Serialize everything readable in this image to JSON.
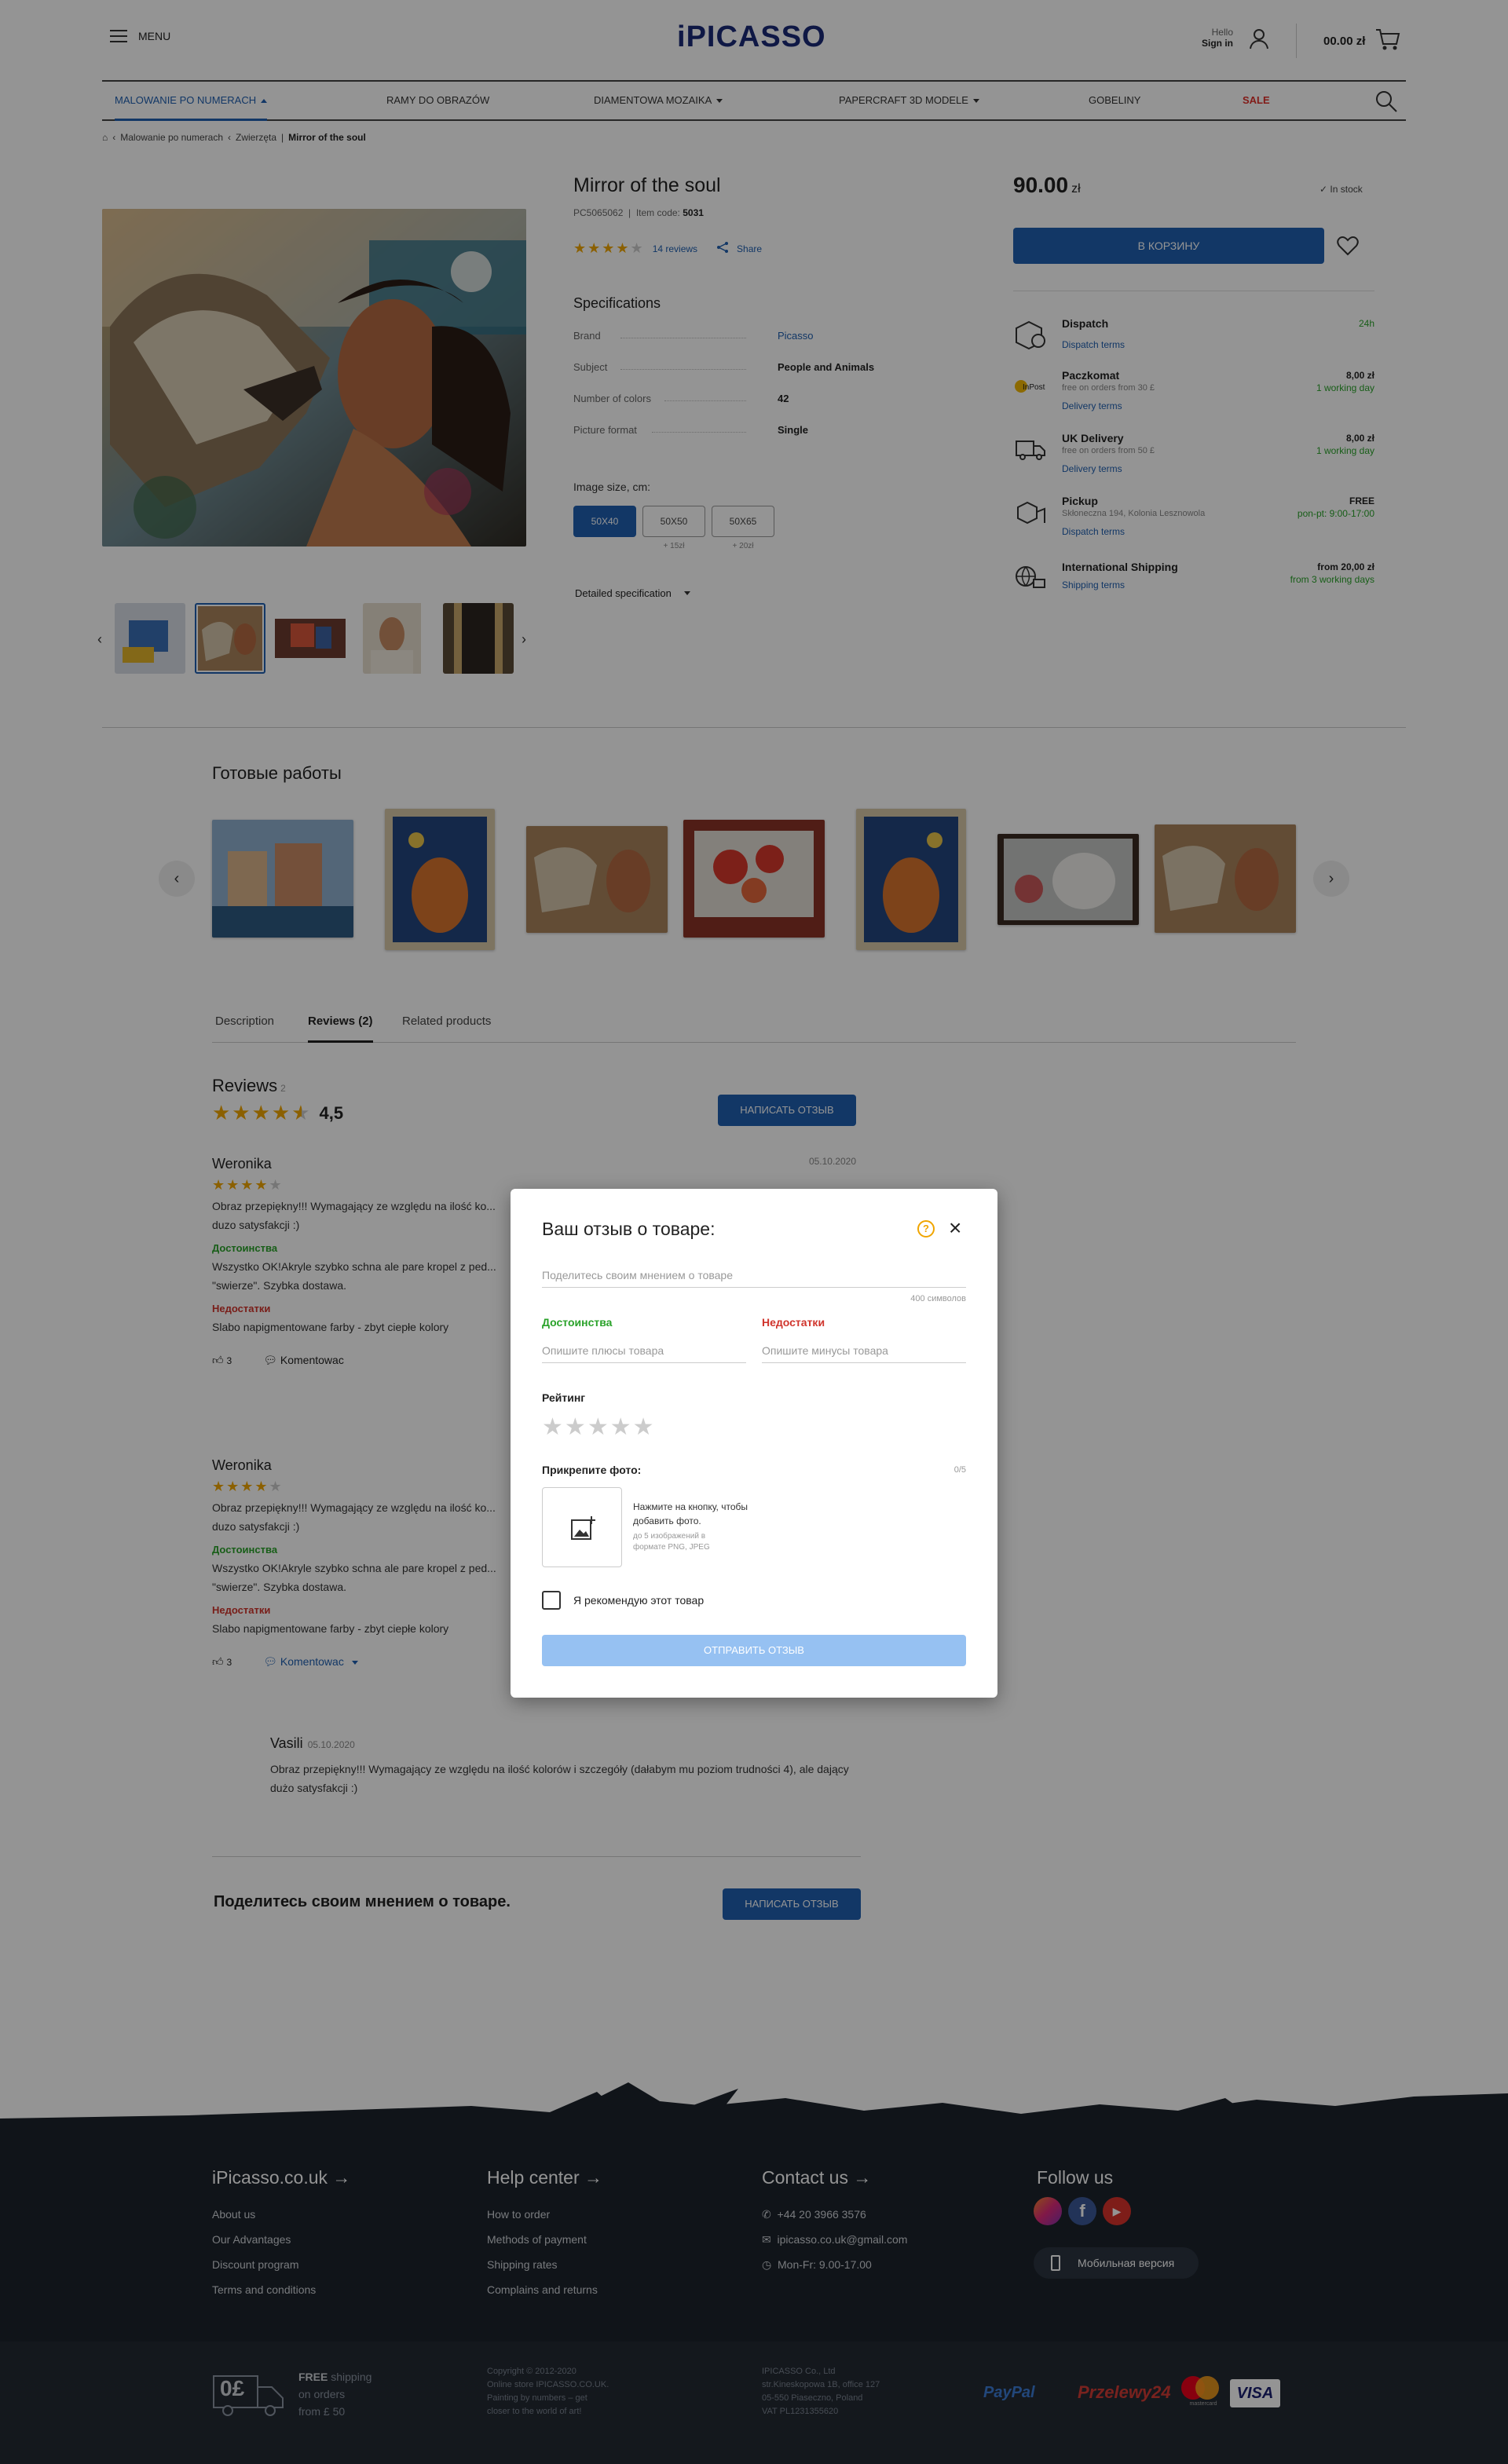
{
  "header": {
    "menu_label": "MENU",
    "logo_prefix": "i",
    "logo_main": "PICASSO",
    "hello": "Hello",
    "sign_in": "Sign in",
    "cart_total": "00.00 zł"
  },
  "nav": {
    "items": [
      "MALOWANIE PO NUMERACH",
      "RAMY DO OBRAZÓW",
      "DIAMENTOWA MOZAIKA",
      "PAPERCRAFT 3D MODELE",
      "GOBELINY",
      "SALE"
    ]
  },
  "breadcrumb": {
    "items": [
      "Malowanie po numerach",
      "Zwierzęta"
    ],
    "current": "Mirror of the soul"
  },
  "product": {
    "title": "Mirror of the soul",
    "code_label": "PC5065062",
    "item_code_label": "Item code:",
    "item_code": "5031",
    "reviews_link": "14 reviews",
    "share": "Share",
    "specs_title": "Specifications",
    "specs": [
      {
        "k": "Brand",
        "v": "Picasso"
      },
      {
        "k": "Subject",
        "v": "People and Animals"
      },
      {
        "k": "Number of colors",
        "v": "42"
      },
      {
        "k": "Picture format",
        "v": "Single"
      }
    ],
    "image_size_label": "Image size, cm:",
    "sizes": [
      {
        "label": "50X40",
        "extra": ""
      },
      {
        "label": "50X50",
        "extra": "+ 15zł"
      },
      {
        "label": "50X65",
        "extra": "+ 20zł"
      }
    ],
    "detailed": "Detailed specification",
    "price": "90.00",
    "currency": "zł",
    "stock": "In stock",
    "buy": "В КОРЗИНУ"
  },
  "shipping": [
    {
      "title": "Dispatch",
      "sub": "",
      "link": "Dispatch terms",
      "r1": "",
      "r2": "24h"
    },
    {
      "title": "Paczkomat",
      "sub": "free on orders from 30 £",
      "link": "Delivery terms",
      "r1": "8,00 zł",
      "r2": "1 working day"
    },
    {
      "title": "UK Delivery",
      "sub": "free on orders from 50 £",
      "link": "Delivery terms",
      "r1": "8,00 zł",
      "r2": "1 working day"
    },
    {
      "title": "Pickup",
      "sub": "Skłoneczna 194, Kolonia Lesznowola",
      "link": "Dispatch terms",
      "r1": "FREE",
      "r2": "pon-pt: 9:00-17:00"
    },
    {
      "title": "International Shipping",
      "sub": "",
      "link": "Shipping terms",
      "r1": "from 20,00 zł",
      "r2": "from 3 working days"
    }
  ],
  "works": {
    "title": "Готовые работы"
  },
  "tabs": [
    "Description",
    "Reviews (2)",
    "Related products"
  ],
  "reviews": {
    "title": "Reviews",
    "count": "2",
    "average": "4,5",
    "average_value": 4.5,
    "write_btn": "НАПИСАТЬ ОТЗЫВ",
    "items": [
      {
        "name": "Weronika",
        "rating": 4,
        "date": "05.10.2020",
        "text": "Obraz przepiękny!!! Wymagający ze względu na ilość ko...\nduzo satysfakcji :)",
        "pros_label": "Достоинства",
        "pros": "Wszystko OK!Akryle szybko schna ale pare kropel z ped...\n\"swierze\". Szybka dostawa.",
        "cons_label": "Недостатки",
        "cons": "Slabo napigmentowane farby - zbyt ciepłe kolory",
        "likes": "3",
        "comment": "Komentowac"
      },
      {
        "name": "Weronika",
        "rating": 4,
        "date": "",
        "text": "Obraz przepiękny!!! Wymagający ze względu na ilość ko...\nduzo satysfakcji :)",
        "pros_label": "Достоинства",
        "pros": "Wszystko OK!Akryle szybko schna ale pare kropel z ped...\n\"swierze\". Szybka dostawa.",
        "cons_label": "Недостатки",
        "cons": "Slabo napigmentowane farby - zbyt ciepłe kolory",
        "likes": "3",
        "comment": "Komentowac"
      }
    ],
    "reply": {
      "name": "Vasili",
      "date": "05.10.2020",
      "text": "Obraz przepiękny!!! Wymagający ze względu na ilość kolorów i szczegóły (dałabym mu poziom trudności 4), ale dający dużo satysfakcji :)"
    },
    "share_question": "Поделитесь своим мнением о товаре.",
    "share_btn": "НАПИСАТЬ ОТЗЫВ"
  },
  "modal": {
    "title": "Ваш отзыв о товаре:",
    "help": "?",
    "opinion_placeholder": "Поделитесь своим мнением о товаре",
    "char_count": "400 символов",
    "pros_label": "Достоинства",
    "pros_placeholder": "Опишите плюсы товара",
    "cons_label": "Недостатки",
    "cons_placeholder": "Опишите минусы товара",
    "rating_label": "Рейтинг",
    "photo_label": "Прикрепите фото:",
    "photo_count": "0/5",
    "upload_text": "Нажмите на кнопку, чтобы добавить фото.",
    "upload_sub": "до 5 изображений в формате PNG, JPEG",
    "recommend": "Я рекомендую этот товар",
    "submit": "ОТПРАВИТЬ ОТЗЫВ"
  },
  "footer": {
    "cols": [
      {
        "title": "iPicasso.co.uk",
        "links": [
          "About us",
          "Our Advantages",
          "Discount program",
          "Terms and conditions"
        ]
      },
      {
        "title": "Help center",
        "links": [
          "How to order",
          "Methods of payment",
          "Shipping rates",
          "Complains and returns"
        ]
      },
      {
        "title": "Contact us",
        "links": [
          "+44 20 3966 3576",
          "ipicasso.co.uk@gmail.com",
          "Mon-Fr: 9.00-17.00"
        ]
      },
      {
        "title": "Follow us",
        "links": []
      }
    ],
    "mobile": "Мобильная версия",
    "free_ship_amount": "0£",
    "free_ship_l1": "FREE",
    "free_ship_l1b": "shipping",
    "free_ship_l2": "on orders",
    "free_ship_l3": "from £ 50",
    "copyright": [
      "Copyright © 2012-2020",
      "Online store IPICASSO.CO.UK.",
      "Painting by numbers – get",
      "closer to the world of art!"
    ],
    "company": [
      "IPICASSO Co., Ltd",
      "str.Kineskopowa 1B, office 127",
      "05-550 Piaseczno, Poland",
      "VAT PL1231355620"
    ],
    "payments": [
      "PayPal",
      "Przelewy24",
      "mastercard",
      "VISA"
    ]
  }
}
